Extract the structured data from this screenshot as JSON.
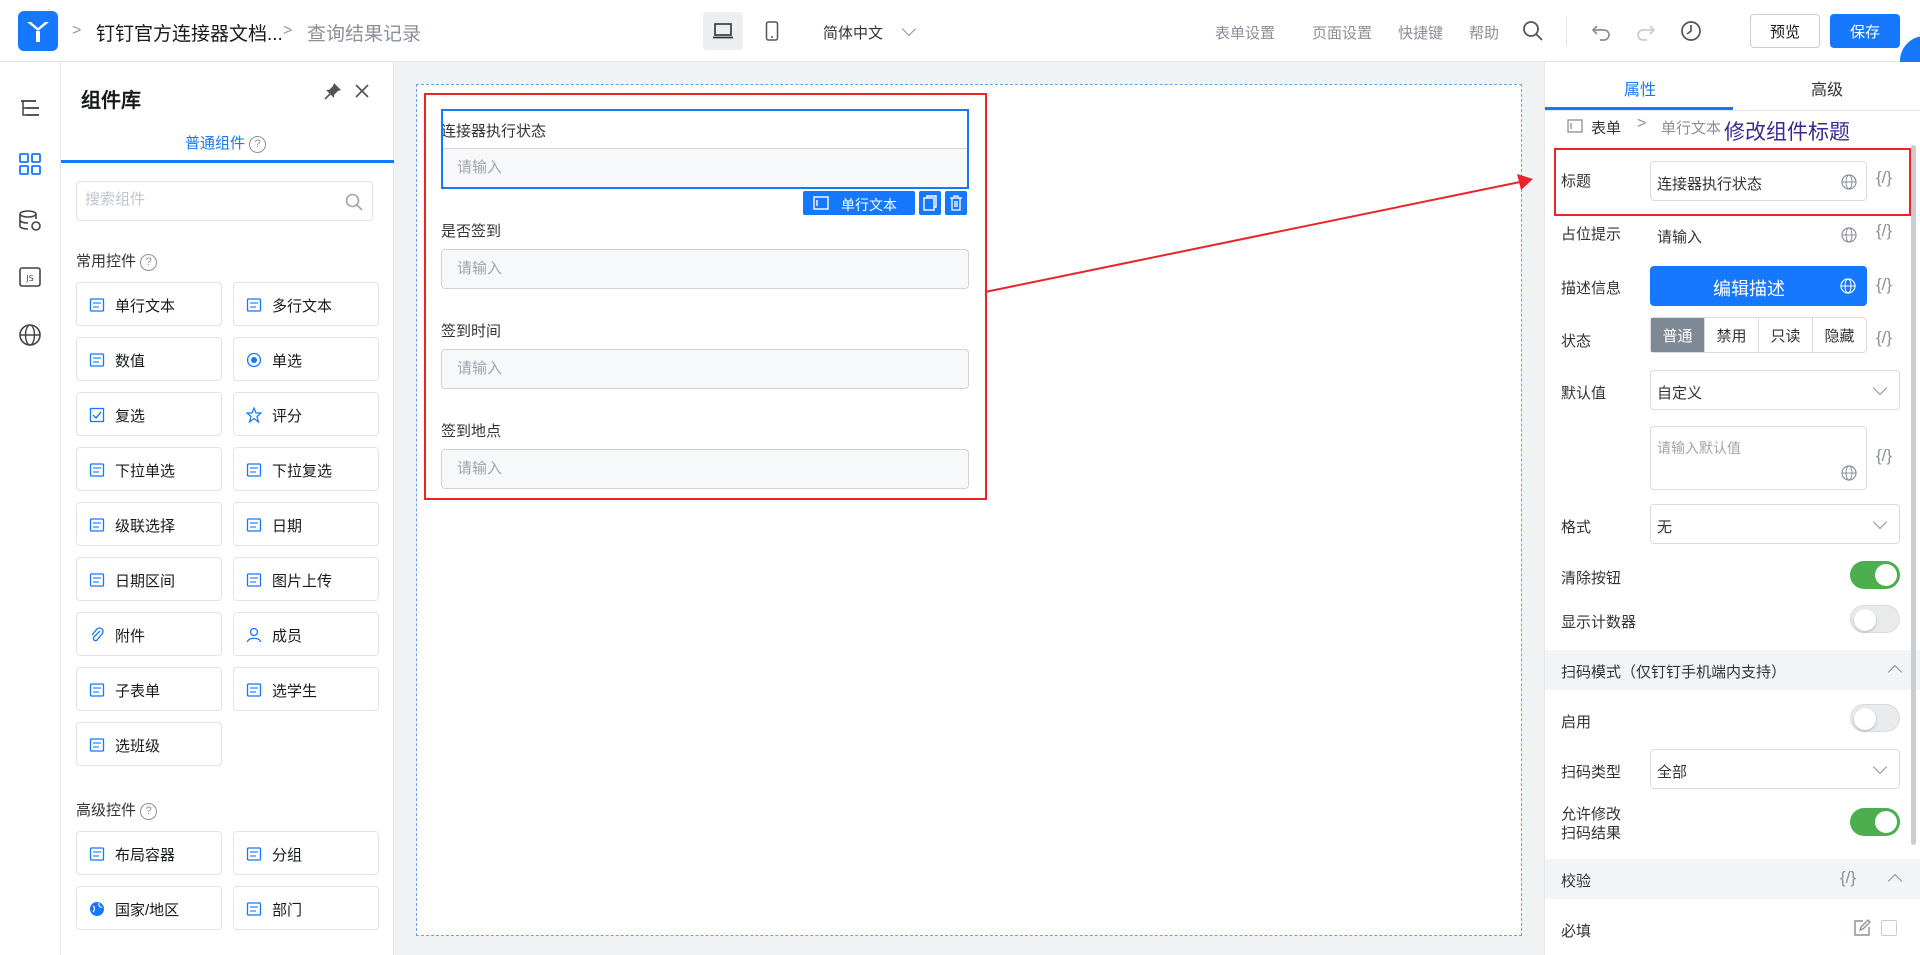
{
  "header": {
    "app_name": "钉钉官方连接器文档...",
    "page_name": "查询结果记录",
    "language": "简体中文",
    "links": [
      "表单设置",
      "页面设置",
      "快捷键",
      "帮助"
    ],
    "preview_label": "预览",
    "save_label": "保存"
  },
  "library": {
    "title": "组件库",
    "tab_label": "普通组件",
    "search_placeholder": "搜索组件",
    "common_label": "常用控件",
    "common_items": [
      {
        "label": "单行文本",
        "icon": "single-line-text-icon"
      },
      {
        "label": "多行文本",
        "icon": "multi-line-text-icon"
      },
      {
        "label": "数值",
        "icon": "number-icon"
      },
      {
        "label": "单选",
        "icon": "radio-icon"
      },
      {
        "label": "复选",
        "icon": "checkbox-icon"
      },
      {
        "label": "评分",
        "icon": "star-icon"
      },
      {
        "label": "下拉单选",
        "icon": "dropdown-single-icon"
      },
      {
        "label": "下拉复选",
        "icon": "dropdown-multi-icon"
      },
      {
        "label": "级联选择",
        "icon": "cascade-icon"
      },
      {
        "label": "日期",
        "icon": "date-icon"
      },
      {
        "label": "日期区间",
        "icon": "date-range-icon"
      },
      {
        "label": "图片上传",
        "icon": "image-upload-icon"
      },
      {
        "label": "附件",
        "icon": "attachment-icon"
      },
      {
        "label": "成员",
        "icon": "member-icon"
      },
      {
        "label": "子表单",
        "icon": "subform-icon"
      },
      {
        "label": "选学生",
        "icon": "student-icon"
      },
      {
        "label": "选班级",
        "icon": "class-icon"
      }
    ],
    "advanced_label": "高级控件",
    "advanced_items": [
      {
        "label": "布局容器",
        "icon": "layout-icon"
      },
      {
        "label": "分组",
        "icon": "group-icon"
      },
      {
        "label": "国家/地区",
        "icon": "globe-icon"
      },
      {
        "label": "部门",
        "icon": "department-icon"
      }
    ]
  },
  "form": {
    "fields": [
      {
        "label": "连接器执行状态",
        "placeholder": "请输入"
      },
      {
        "label": "是否签到",
        "placeholder": "请输入"
      },
      {
        "label": "签到时间",
        "placeholder": "请输入"
      },
      {
        "label": "签到地点",
        "placeholder": "请输入"
      }
    ],
    "selected_tag": "单行文本"
  },
  "props": {
    "tabs": [
      "属性",
      "高级"
    ],
    "breadcrumb": [
      "表单",
      "单行文本"
    ],
    "annotation": "修改组件标题",
    "title_label": "标题",
    "title_value": "连接器执行状态",
    "placeholder_label": "占位提示",
    "placeholder_value": "请输入",
    "desc_label": "描述信息",
    "desc_button": "编辑描述",
    "status_label": "状态",
    "status_options": [
      "普通",
      "禁用",
      "只读",
      "隐藏"
    ],
    "default_label": "默认值",
    "default_mode": "自定义",
    "default_placeholder": "请输入默认值",
    "format_label": "格式",
    "format_value": "无",
    "clear_label": "清除按钮",
    "clear_on": true,
    "counter_label": "显示计数器",
    "counter_on": false,
    "scan_section": "扫码模式（仅钉钉手机端内支持）",
    "scan_enable_label": "启用",
    "scan_enable_on": false,
    "scan_type_label": "扫码类型",
    "scan_type_value": "全部",
    "allow_edit_label_1": "允许修改",
    "allow_edit_label_2": "扫码结果",
    "allow_edit_on": true,
    "validate_section": "校验",
    "required_label": "必填",
    "curly": "{/}"
  },
  "colors": {
    "accent": "#1677ff",
    "annotation_red": "#e8262a",
    "toggle_on": "#4cae4f"
  }
}
